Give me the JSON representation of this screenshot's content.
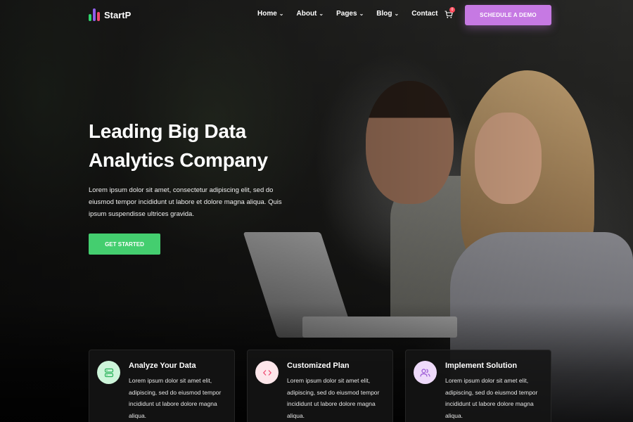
{
  "brand": {
    "name": "StartP",
    "bar_colors": [
      "#2fd36b",
      "#8e5fe8",
      "#ef476f"
    ]
  },
  "nav": {
    "items": [
      {
        "label": "Home",
        "has_dropdown": true
      },
      {
        "label": "About",
        "has_dropdown": true
      },
      {
        "label": "Pages",
        "has_dropdown": true
      },
      {
        "label": "Blog",
        "has_dropdown": true
      },
      {
        "label": "Contact",
        "has_dropdown": false
      }
    ],
    "dropdown_glyph": "⌄",
    "cart_count": "0",
    "cart_icon": "cart-icon",
    "demo_button": "Schedule a Demo"
  },
  "hero": {
    "title_line1": "Leading Big Data",
    "title_line2": "Analytics Company",
    "description": "Lorem ipsum dolor sit amet, consectetur adipiscing elit, sed do eiusmod tempor incididunt ut labore et dolore magna aliqua. Quis ipsum suspendisse ultrices gravida.",
    "cta": "Get Started"
  },
  "features": [
    {
      "title": "Analyze Your Data",
      "text": "Lorem ipsum dolor sit amet elit, adipiscing, sed do eiusmod tempor incididunt ut labore dolore magna aliqua.",
      "icon": "server-icon"
    },
    {
      "title": "Customized Plan",
      "text": "Lorem ipsum dolor sit amet elit, adipiscing, sed do eiusmod tempor incididunt ut labore dolore magna aliqua.",
      "icon": "code-icon"
    },
    {
      "title": "Implement Solution",
      "text": "Lorem ipsum dolor sit amet elit, adipiscing, sed do eiusmod tempor incididunt ut labore dolore magna aliqua.",
      "icon": "users-icon"
    }
  ],
  "colors": {
    "accent_green": "#44ce6f",
    "accent_purple": "#c679e3",
    "badge_red": "#ff4b5c",
    "icon_green_bg": "#cdf5da",
    "icon_pink_bg": "#fde6ea",
    "icon_purple_bg": "#eedafa"
  }
}
